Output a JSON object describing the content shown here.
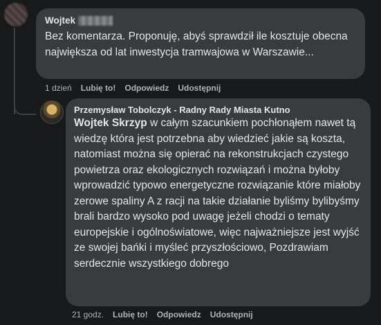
{
  "comment1": {
    "author": "Wojtek",
    "text": "Bez komentarza. Proponuję, abyś sprawdził ile kosztuje obecna największa od lat inwestycja tramwajowa w Warszawie...",
    "time": "1 dzień",
    "like": "Lubię to!",
    "reply": "Odpowiedz",
    "share": "Udostępnij"
  },
  "comment2": {
    "author": "Przemysław Tobolczyk - Radny Rady Miasta Kutno",
    "mention": "Wojtek Skrzyp",
    "text": " w całym szacunkiem pochłonąłem nawet tą wiedzę która jest potrzebna aby wiedzieć jakie są koszta, natomiast można się opierać na rekonstrukcjach czystego powietrza oraz ekologicznych rozwiązań i można byłoby wprowadzić typowo energetyczne rozwiązanie które miałoby zerowe spaliny A z racji na takie działanie byliśmy bylibyśmy brali bardzo wysoko pod uwagę jeżeli chodzi o tematy europejskie i ogólnoświatowe, więc najważniejsze jest wyjść ze swojej bańki i myśleć przyszłościowo, Pozdrawiam serdecznie wszystkiego dobrego",
    "time": "21 godz.",
    "like": "Lubię to!",
    "reply": "Odpowiedz",
    "share": "Udostępnij"
  }
}
